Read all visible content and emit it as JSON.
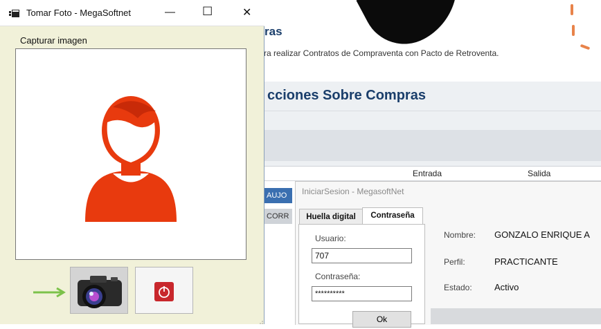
{
  "window": {
    "title": "Tomar Foto - MegaSoftnet",
    "minimize_glyph": "—",
    "maximize_glyph": "☐",
    "close_glyph": "✕",
    "group_label": "Capturar imagen",
    "buttons": {
      "capture_icon": "camera-icon",
      "stop_icon": "power-stop-icon"
    },
    "arrow_color": "#7cc24a",
    "avatar_color": "#e83a0e"
  },
  "background": {
    "heading_fragment": "ras",
    "subtitle_fragment": "ra realizar Contratos de Compraventa con Pacto de Retroventa.",
    "section_title_fragment": "cciones Sobre Compras",
    "columns": [
      "Entrada",
      "Salida"
    ],
    "row_badges": [
      "AUJO",
      "CORR"
    ],
    "accent_color": "#1a3e6b",
    "badge_color": "#3a6fb0"
  },
  "login": {
    "title": "IniciarSesion - MegasoftNet",
    "tabs": [
      "Huella digital",
      "Contraseña"
    ],
    "user_label": "Usuario:",
    "user_value": "707",
    "password_label": "Contraseña:",
    "password_value": "**********",
    "ok_label": "Ok",
    "name_label": "Nombre:",
    "name_value": "GONZALO ENRIQUE A",
    "profile_label": "Perfil:",
    "profile_value": "PRACTICANTE",
    "status_label": "Estado:",
    "status_value": "Activo"
  }
}
